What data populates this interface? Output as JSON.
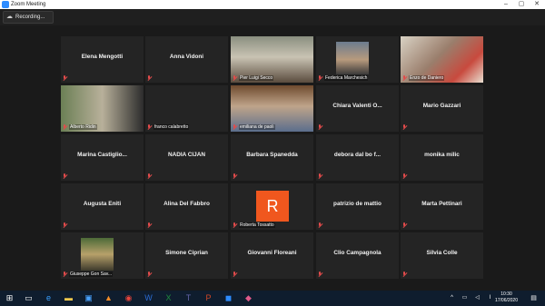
{
  "window": {
    "title": "Zoom Meeting"
  },
  "recording": {
    "label": "Recording..."
  },
  "participants": [
    {
      "name": "Elena Mengotti",
      "label": "",
      "video": false
    },
    {
      "name": "Anna Vidoni",
      "label": "",
      "video": false
    },
    {
      "name": "",
      "label": "Pier Luigi Secco",
      "video": true,
      "active": true
    },
    {
      "name": "",
      "label": "Federica Marchesich",
      "video": true
    },
    {
      "name": "",
      "label": "Enzo de Daniero",
      "video": true
    },
    {
      "name": "",
      "label": "Alberto Ridin",
      "video": true
    },
    {
      "name": "",
      "label": "franco calabretto",
      "video": false
    },
    {
      "name": "",
      "label": "emiliana de paoli",
      "video": true
    },
    {
      "name": "Chiara Valenti O...",
      "label": "",
      "video": false
    },
    {
      "name": "Mario Gazzari",
      "label": "",
      "video": false
    },
    {
      "name": "Marina Castiglio...",
      "label": "",
      "video": false
    },
    {
      "name": "NADIA CIJAN",
      "label": "",
      "video": false
    },
    {
      "name": "Barbara Spanedda",
      "label": "",
      "video": false
    },
    {
      "name": "debora dal bo f...",
      "label": "",
      "video": false
    },
    {
      "name": "monika milic",
      "label": "",
      "video": false
    },
    {
      "name": "Augusta Eniti",
      "label": "",
      "video": false
    },
    {
      "name": "Alina Del Fabbro",
      "label": "",
      "video": false
    },
    {
      "name": "",
      "label": "Roberta Tossatto",
      "video": false,
      "avatar": "R"
    },
    {
      "name": "patrizio de mattio",
      "label": "",
      "video": false
    },
    {
      "name": "Marta Pettinari",
      "label": "",
      "video": false
    },
    {
      "name": "",
      "label": "Giuseppe Gon Sav...",
      "video": true
    },
    {
      "name": "Simone Ciprian",
      "label": "",
      "video": false
    },
    {
      "name": "Giovanni Floreani",
      "label": "",
      "video": false
    },
    {
      "name": "Clio Campagnola",
      "label": "",
      "video": false
    },
    {
      "name": "Silvia Colle",
      "label": "",
      "video": false
    }
  ],
  "taskbar": {
    "time": "10:30",
    "date": "17/06/2020"
  },
  "colors": {
    "active_border": "#b4d849",
    "avatar_bg": "#f0571e",
    "tile_bg": "#242424",
    "muted_mic": "#e24b4b"
  }
}
